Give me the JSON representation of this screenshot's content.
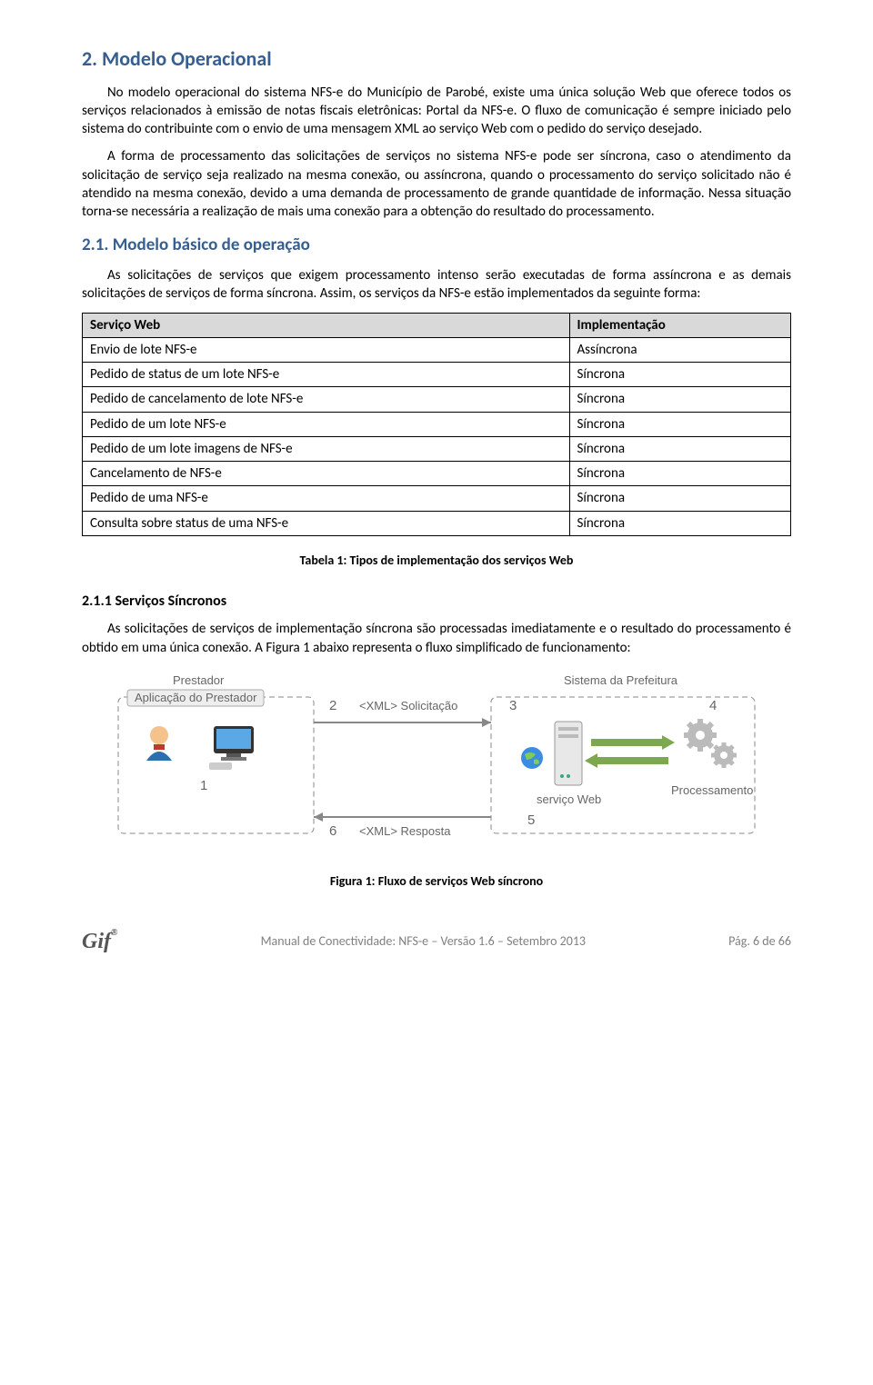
{
  "section2": {
    "title": "2. Modelo Operacional",
    "p1": "No modelo operacional do sistema NFS-e do Município de Parobé, existe uma única solução Web que oferece todos os serviços relacionados à emissão de notas fiscais eletrônicas: Portal da NFS-e. O fluxo de comunicação é sempre iniciado pelo sistema do contribuinte com o envio de uma mensagem XML ao serviço Web com o pedido do serviço desejado.",
    "p2": "A forma de processamento das solicitações de serviços no sistema NFS-e pode ser síncrona, caso o atendimento da solicitação de serviço seja realizado na mesma conexão, ou assíncrona, quando o processamento do serviço solicitado não é atendido na mesma conexão, devido a uma demanda de processamento de grande quantidade de informação. Nessa situação torna-se necessária a realização de mais uma conexão para a obtenção do resultado do processamento."
  },
  "section21": {
    "title": "2.1. Modelo básico de operação",
    "p1": "As solicitações de serviços que exigem processamento intenso serão executadas de forma assíncrona e as demais solicitações de serviços de forma síncrona. Assim, os serviços da NFS-e estão implementados da seguinte forma:"
  },
  "impl_table": {
    "headers": [
      "Serviço Web",
      "Implementação"
    ],
    "rows": [
      [
        "Envio de lote NFS-e",
        "Assíncrona"
      ],
      [
        "Pedido de status de um lote NFS-e",
        "Síncrona"
      ],
      [
        "Pedido de cancelamento de lote NFS-e",
        "Síncrona"
      ],
      [
        "Pedido de um lote NFS-e",
        "Síncrona"
      ],
      [
        "Pedido de um lote imagens de NFS-e",
        "Síncrona"
      ],
      [
        "Cancelamento de NFS-e",
        "Síncrona"
      ],
      [
        "Pedido de uma NFS-e",
        "Síncrona"
      ],
      [
        "Consulta sobre status de uma NFS-e",
        "Síncrona"
      ]
    ],
    "caption": "Tabela 1: Tipos de implementação dos serviços Web"
  },
  "section211": {
    "title": "2.1.1 Serviços Síncronos",
    "p1": "As solicitações de serviços de implementação síncrona são processadas imediatamente e o resultado do processamento é obtido em uma única conexão. A Figura 1 abaixo representa o fluxo simplificado de funcionamento:"
  },
  "diagram": {
    "left_title": "Prestador",
    "left_box": "Aplicação do Prestador",
    "right_title": "Sistema da Prefeitura",
    "xml_req": "<XML> Solicitação",
    "xml_resp": "<XML> Resposta",
    "service_web": "serviço Web",
    "processing": "Processamento",
    "n1": "1",
    "n2": "2",
    "n3": "3",
    "n4": "4",
    "n5": "5",
    "n6": "6",
    "caption": "Figura 1: Fluxo de serviços Web síncrono"
  },
  "footer": {
    "logo": "Gif",
    "center": "Manual de Conectividade: NFS-e – Versão 1.6 – Setembro 2013",
    "right": "Pág. 6 de 66"
  }
}
